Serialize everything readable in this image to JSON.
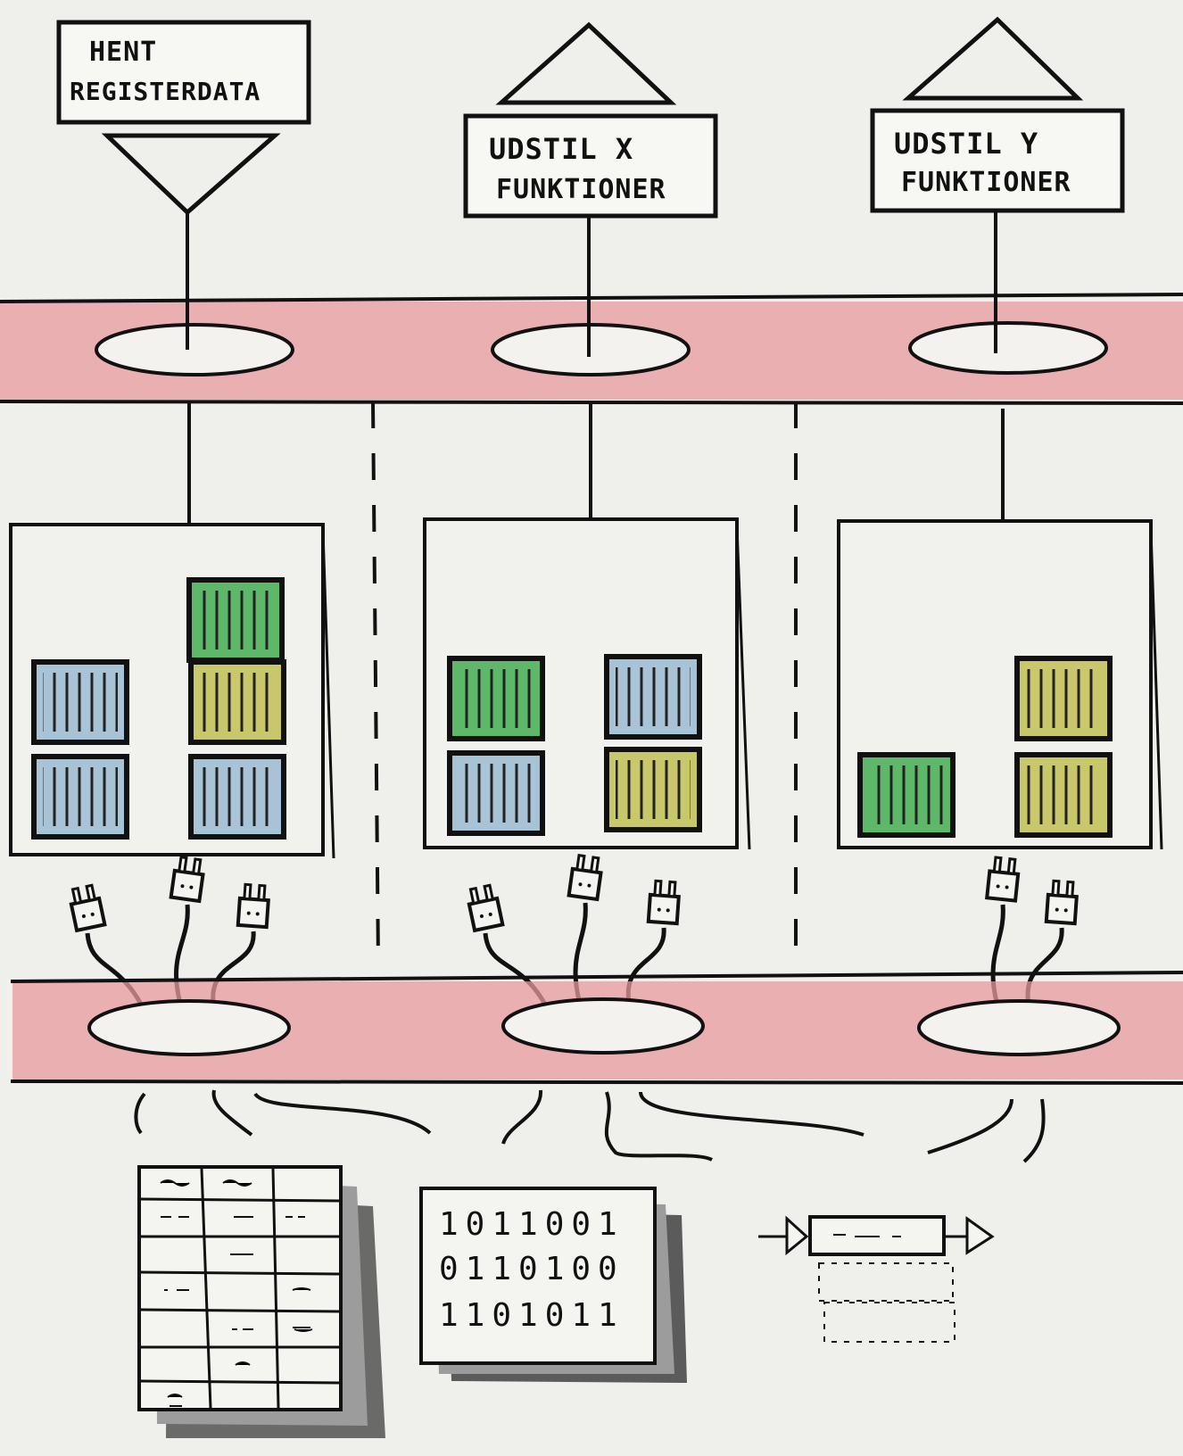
{
  "services": [
    {
      "id": "hent",
      "line1": "HENT",
      "line2": "REGISTERDATA"
    },
    {
      "id": "x",
      "line1": "UDSTIL X",
      "line2": "FUNKTIONER"
    },
    {
      "id": "y",
      "line1": "UDSTIL Y",
      "line2": "FUNKTIONER"
    }
  ],
  "binary_rows": [
    "1011001",
    "0110100",
    "1101011"
  ],
  "colors": {
    "band": "#e89a9c",
    "blue": "#a9c3d6",
    "green": "#5eb86a",
    "olive": "#c8c86a",
    "paper": "#efefec",
    "ink": "#111111"
  },
  "modules": [
    {
      "cubes": [
        "blue",
        "blue",
        "green",
        "olive",
        "blue"
      ]
    },
    {
      "cubes": [
        "green",
        "blue",
        "blue",
        "olive"
      ]
    },
    {
      "cubes": [
        "green",
        "olive",
        "olive"
      ]
    }
  ],
  "icons": {
    "interface": "triangle-icon",
    "plug": "plug-icon",
    "table_doc": "table-document-icon",
    "binary_doc": "binary-document-icon",
    "stream": "message-stream-icon"
  }
}
